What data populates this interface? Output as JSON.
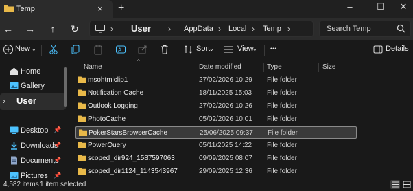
{
  "window": {
    "tab_title": "Temp",
    "tab_close": "×",
    "new_tab": "+",
    "minimize": "–",
    "maximize": "☐",
    "close": "✕"
  },
  "nav": {
    "back": "←",
    "forward": "→",
    "up": "↑",
    "refresh": "↻"
  },
  "address": {
    "crumbs": [
      "User",
      "AppData",
      "Local",
      "Temp"
    ],
    "search_placeholder": "Search Temp"
  },
  "toolbar": {
    "new_label": "New",
    "sort_label": "Sort",
    "view_label": "View",
    "more_label": "•••",
    "details_label": "Details"
  },
  "sidebar": {
    "items": [
      {
        "label": "Home",
        "icon": "home-icon"
      },
      {
        "label": "Gallery",
        "icon": "gallery-icon"
      },
      {
        "label": "User",
        "icon": "caret-right-icon"
      },
      {
        "label": "Desktop",
        "icon": "desktop-icon"
      },
      {
        "label": "Downloads",
        "icon": "downloads-icon"
      },
      {
        "label": "Documents",
        "icon": "documents-icon"
      },
      {
        "label": "Pictures",
        "icon": "pictures-icon"
      }
    ]
  },
  "columns": {
    "name": "Name",
    "date": "Date modified",
    "type": "Type",
    "size": "Size"
  },
  "files": [
    {
      "name": "msohtmlclip1",
      "date": "27/02/2026 10:29",
      "type": "File folder"
    },
    {
      "name": "Notification Cache",
      "date": "18/11/2025 15:03",
      "type": "File folder"
    },
    {
      "name": "Outlook Logging",
      "date": "27/02/2026 10:26",
      "type": "File folder"
    },
    {
      "name": "PhotoCache",
      "date": "05/02/2026 10:01",
      "type": "File folder"
    },
    {
      "name": "PokerStarsBrowserCache",
      "date": "25/06/2025 09:37",
      "type": "File folder",
      "selected": true
    },
    {
      "name": "PowerQuery",
      "date": "05/11/2025 14:22",
      "type": "File folder"
    },
    {
      "name": "scoped_dir924_1587597063",
      "date": "09/09/2025 08:07",
      "type": "File folder"
    },
    {
      "name": "scoped_dir1124_1143543967",
      "date": "29/09/2025 12:36",
      "type": "File folder"
    }
  ],
  "status": {
    "items_count": "4,582 items",
    "selected": "1 item selected"
  },
  "colors": {
    "folder": "#e9b949",
    "accent": "#4cc2ff"
  }
}
